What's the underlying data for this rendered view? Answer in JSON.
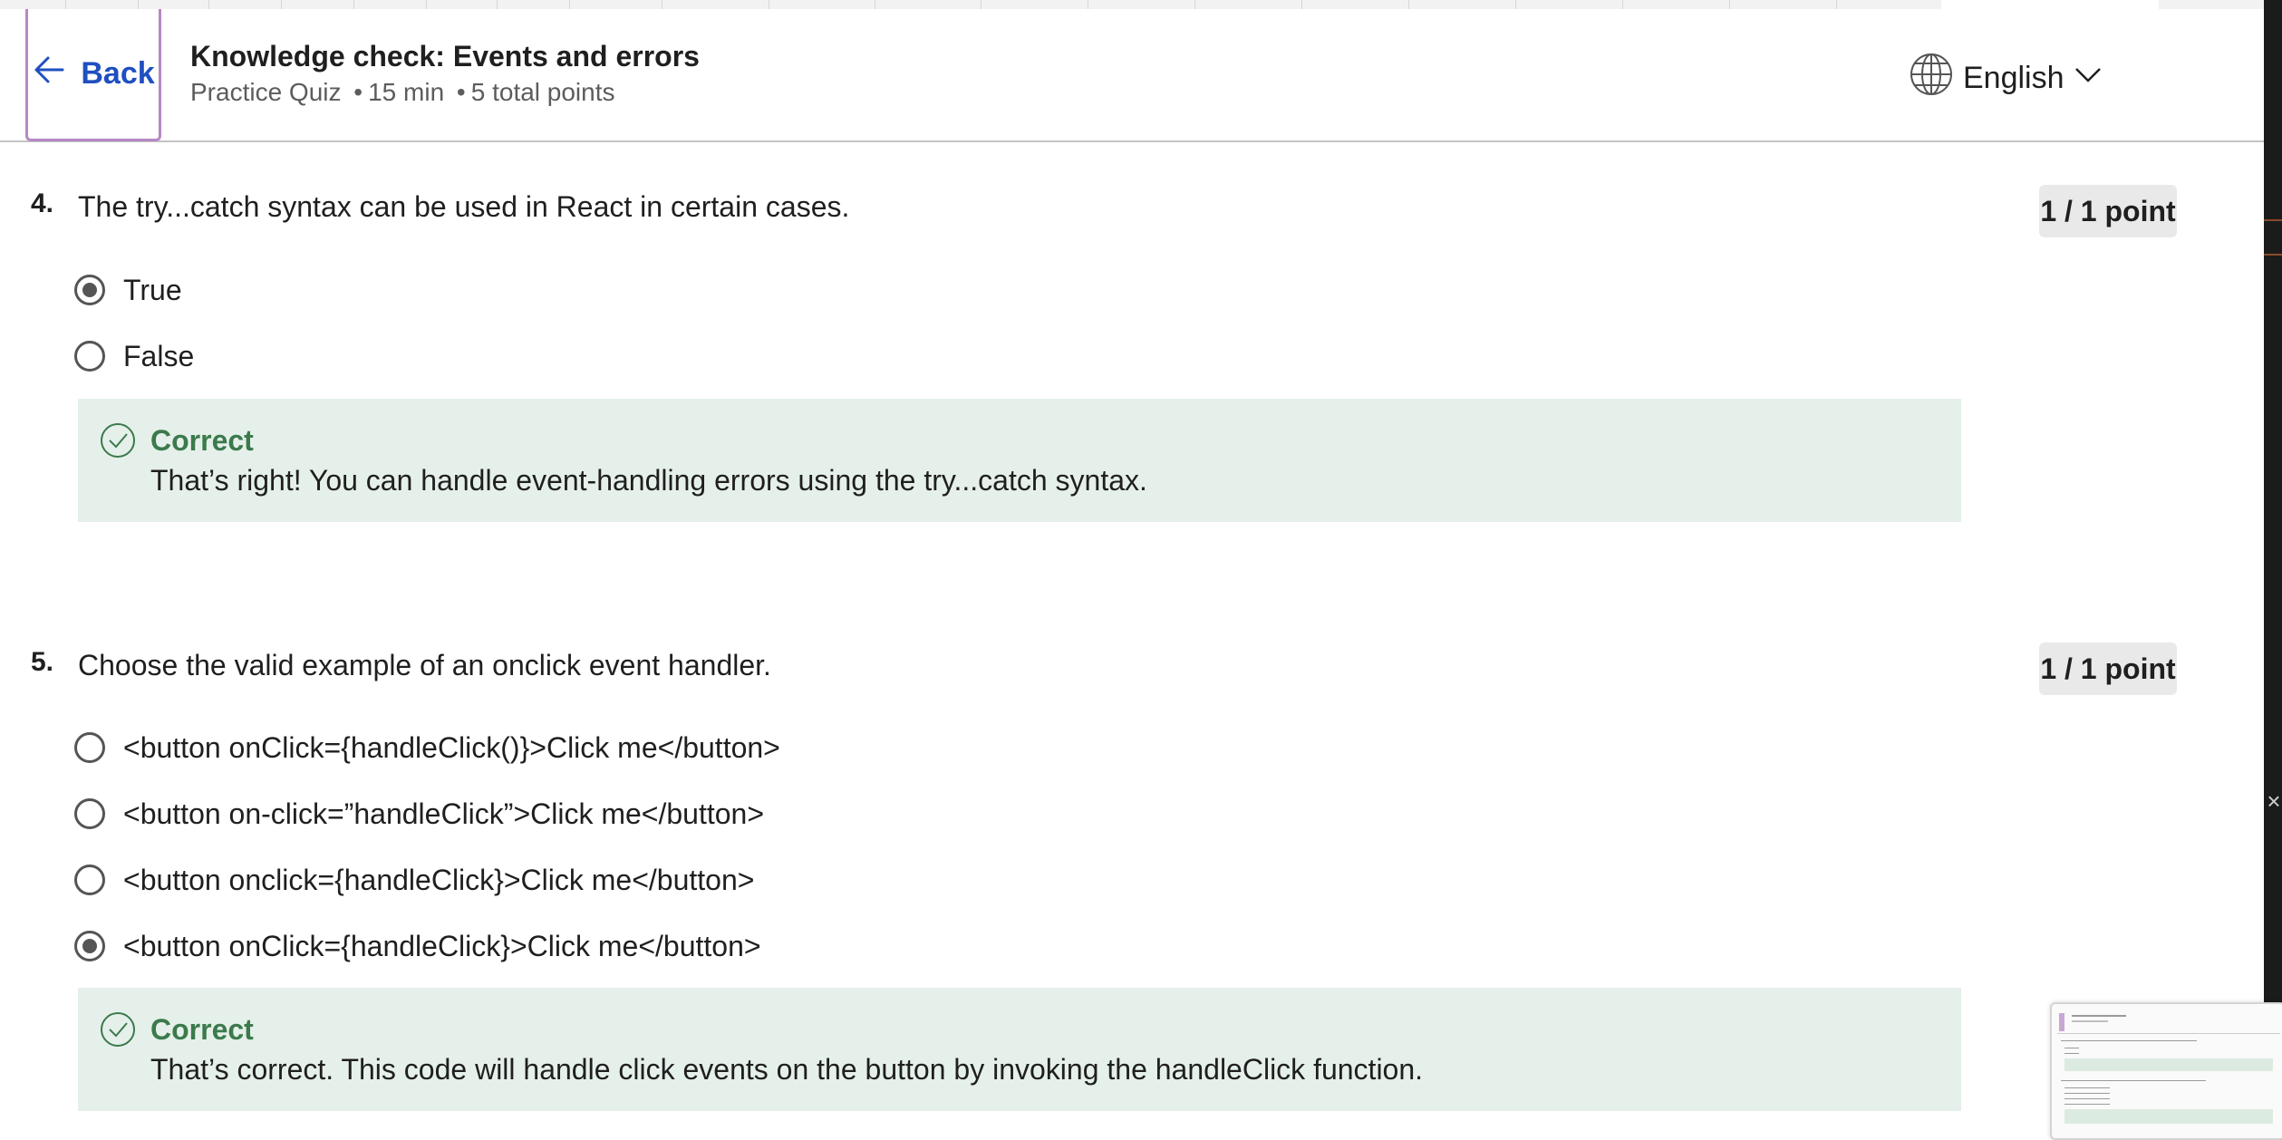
{
  "header": {
    "back_label": "Back",
    "title": "Knowledge check: Events and errors",
    "subtitle_type": "Practice Quiz",
    "subtitle_duration": "15 min",
    "subtitle_points": "5 total points",
    "separator": "•",
    "language": "English"
  },
  "questions": [
    {
      "number": "4.",
      "text": "The try...catch syntax can be used in React in certain cases.",
      "points": "1 / 1 point",
      "options": [
        {
          "label": "True",
          "selected": true
        },
        {
          "label": "False",
          "selected": false
        }
      ],
      "feedback": {
        "status": "Correct",
        "message": "That’s right! You can handle event-handling errors using the try...catch syntax."
      }
    },
    {
      "number": "5.",
      "text": "Choose the valid example of an onclick event handler.",
      "points": "1 / 1 point",
      "options": [
        {
          "label": "<button onClick={handleClick()}>Click me</button>",
          "selected": false
        },
        {
          "label": "<button on-click=”handleClick”>Click me</button>",
          "selected": false
        },
        {
          "label": "<button onclick={handleClick}>Click me</button>",
          "selected": false
        },
        {
          "label": "<button onClick={handleClick}>Click me</button>",
          "selected": true
        }
      ],
      "feedback": {
        "status": "Correct",
        "message": "That’s correct. This code will handle click events on the button by invoking the handleClick function."
      }
    }
  ],
  "colors": {
    "accent_blue": "#1f4fc0",
    "focus_outline": "#b588c4",
    "correct_green": "#3b7a4c",
    "feedback_bg": "#e6f0ea",
    "points_bg": "#e9e9e9"
  },
  "icons": {
    "back": "arrow-left-icon",
    "language": "globe-icon",
    "dropdown": "chevron-down-icon",
    "correct": "check-circle-icon",
    "close": "close-icon"
  }
}
